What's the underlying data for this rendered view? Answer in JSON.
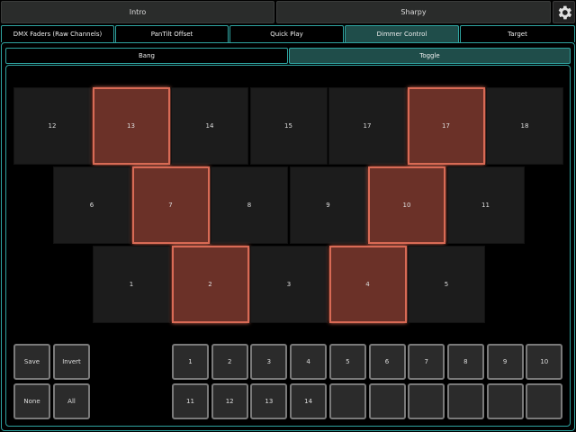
{
  "header": {
    "buttons": [
      "Intro",
      "Sharpy"
    ]
  },
  "tabs": [
    {
      "label": "DMX Faders (Raw Channels)",
      "active": false
    },
    {
      "label": "PanTilt Offset",
      "active": false
    },
    {
      "label": "Quick Play",
      "active": false
    },
    {
      "label": "Dimmer Control",
      "active": true
    },
    {
      "label": "Target",
      "active": false
    }
  ],
  "subtabs": [
    {
      "label": "Bang",
      "active": false
    },
    {
      "label": "Toggle",
      "active": true
    }
  ],
  "grid": {
    "rows": [
      [
        {
          "label": "12",
          "on": false
        },
        {
          "label": "13",
          "on": true
        },
        {
          "label": "14",
          "on": false
        },
        {
          "label": "15",
          "on": false
        },
        {
          "label": "17",
          "on": false
        },
        {
          "label": "17",
          "on": true
        },
        {
          "label": "18",
          "on": false
        }
      ],
      [
        {
          "label": "6",
          "on": false
        },
        {
          "label": "7",
          "on": true
        },
        {
          "label": "8",
          "on": false
        },
        {
          "label": "9",
          "on": false
        },
        {
          "label": "10",
          "on": true
        },
        {
          "label": "11",
          "on": false
        }
      ],
      [
        {
          "label": "1",
          "on": false
        },
        {
          "label": "2",
          "on": true
        },
        {
          "label": "3",
          "on": false
        },
        {
          "label": "4",
          "on": true
        },
        {
          "label": "5",
          "on": false
        }
      ]
    ]
  },
  "controls": {
    "save": "Save",
    "invert": "Invert",
    "none": "None",
    "all": "All"
  },
  "presets": [
    "1",
    "2",
    "3",
    "4",
    "5",
    "6",
    "7",
    "8",
    "9",
    "10",
    "11",
    "12",
    "13",
    "14",
    "",
    "",
    "",
    "",
    "",
    ""
  ],
  "colors": {
    "accent": "#2fa3a0",
    "on_fill": "#6b3128",
    "on_border": "#d86a55"
  },
  "icons": {
    "settings": "gear-icon"
  }
}
